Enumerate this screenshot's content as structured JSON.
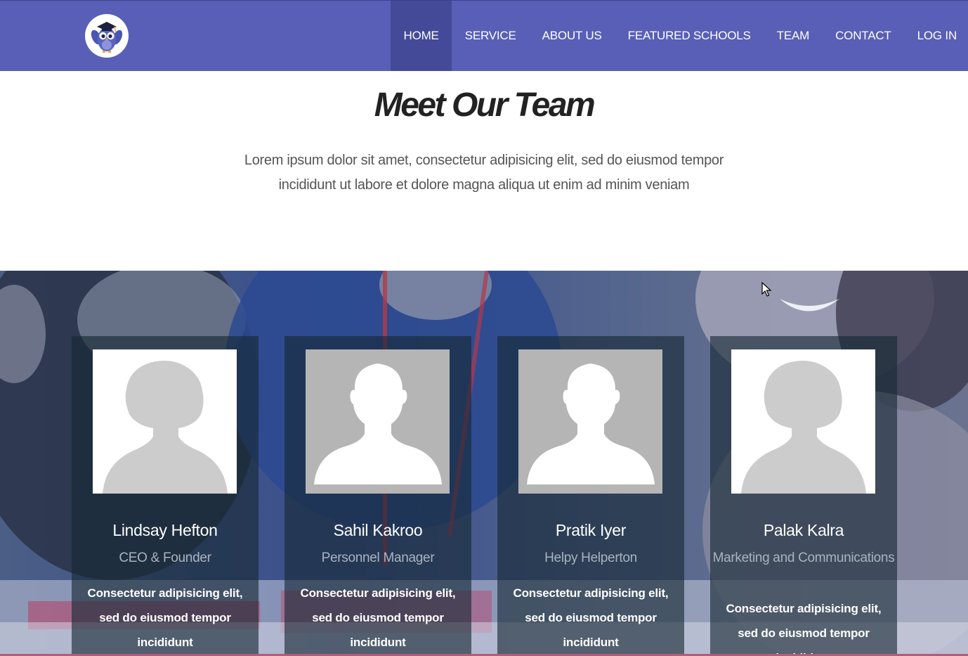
{
  "navbar": {
    "logo_icon": "owl-graduate-icon",
    "items": [
      {
        "label": "HOME",
        "active": true
      },
      {
        "label": "SERVICE"
      },
      {
        "label": "ABOUT US"
      },
      {
        "label": "FEATURED SCHOOLS"
      },
      {
        "label": "TEAM"
      },
      {
        "label": "CONTACT"
      },
      {
        "label": "LOG IN"
      }
    ]
  },
  "section": {
    "title": "Meet Our Team",
    "intro_line1": "Lorem ipsum dolor sit amet, consectetur adipisicing elit, sed do eiusmod tempor",
    "intro_line2": "incididunt ut labore et dolore magna aliqua ut enim ad minim veniam"
  },
  "team": [
    {
      "name": "Lindsay Hefton",
      "role": "CEO & Founder",
      "description": "Consectetur adipisicing elit, sed do eiusmod tempor incididunt",
      "avatar": "female-avatar-icon"
    },
    {
      "name": "Sahil Kakroo",
      "role": "Personnel Manager",
      "description": "Consectetur adipisicing elit, sed do eiusmod tempor incididunt",
      "avatar": "male-avatar-icon"
    },
    {
      "name": "Pratik Iyer",
      "role": "Helpy Helperton",
      "description": "Consectetur adipisicing elit, sed do eiusmod tempor incididunt",
      "avatar": "male-avatar-icon"
    },
    {
      "name": "Palak Kalra",
      "role": "Marketing and Communications",
      "description": "Consectetur adipisicing elit, sed do eiusmod tempor incididunt",
      "avatar": "female-avatar-icon"
    }
  ],
  "colors": {
    "nav_bg": "#595fb6",
    "nav_active": "#454a98",
    "card_overlay": "#162834"
  }
}
